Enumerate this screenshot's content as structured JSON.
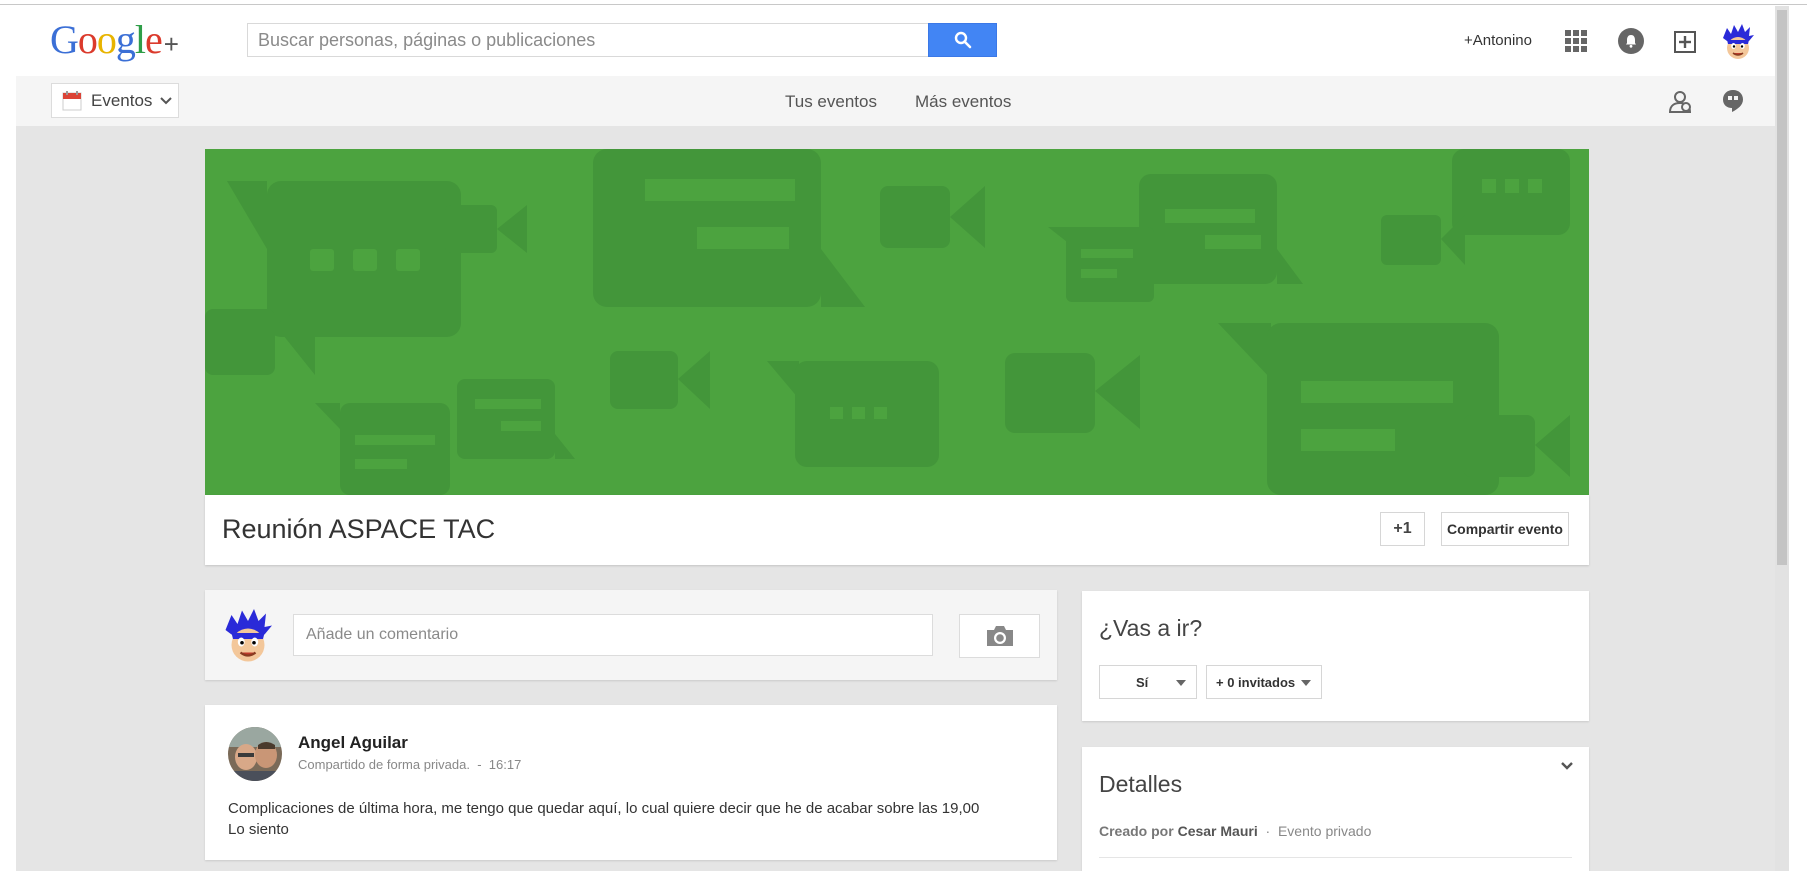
{
  "header": {
    "logo": {
      "g1": "G",
      "o1": "o",
      "o2": "o",
      "g2": "g",
      "l": "l",
      "e": "e",
      "plus": "+"
    },
    "search": {
      "placeholder": "Buscar personas, páginas o publicaciones",
      "button_icon": "search-icon"
    },
    "user_link": "+Antonino",
    "icons": [
      "apps-grid-icon",
      "notifications-bell-icon",
      "share-box-icon",
      "user-avatar"
    ]
  },
  "subheader": {
    "app_menu": {
      "label": "Eventos",
      "icon": "calendar-icon"
    },
    "nav": [
      {
        "label": "Tus eventos"
      },
      {
        "label": "Más eventos"
      }
    ],
    "right_icons": [
      "people-icon",
      "hangouts-icon"
    ]
  },
  "event": {
    "title": "Reunión ASPACE TAC",
    "plus_one": "+1",
    "share_label": "Compartir evento"
  },
  "composer": {
    "placeholder": "Añade un comentario",
    "camera_icon": "camera-icon"
  },
  "post": {
    "author": "Angel Aguilar",
    "visibility": "Compartido de forma privada.",
    "separator": "-",
    "time": "16:17",
    "text_line1": "Complicaciones de última hora, me tengo que quedar aquí, lo cual quiere decir que he de acabar sobre las 19,00",
    "text_line2": "Lo siento"
  },
  "rsvp": {
    "title": "¿Vas a ir?",
    "answer": "Sí",
    "guests": "+ 0 invitados"
  },
  "details": {
    "title": "Detalles",
    "created_prefix": "Creado por",
    "creator": "Cesar Mauri",
    "dot": "·",
    "privacy": "Evento privado"
  },
  "colors": {
    "banner_green": "#4ca33f",
    "banner_shape": "#43963a",
    "search_blue": "#4285f4",
    "content_bg": "#e5e5e5"
  }
}
